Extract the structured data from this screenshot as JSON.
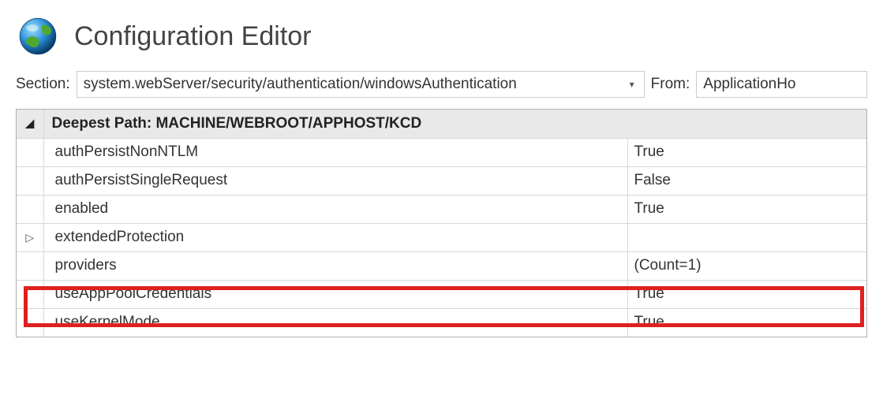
{
  "header": {
    "title": "Configuration Editor"
  },
  "toolbar": {
    "section_label": "Section:",
    "section_value": "system.webServer/security/authentication/windowsAuthentication",
    "from_label": "From:",
    "from_value": "ApplicationHo"
  },
  "grid": {
    "header_label": "Deepest Path: ",
    "header_path": "MACHINE/WEBROOT/APPHOST/KCD",
    "rows": [
      {
        "name": "authPersistNonNTLM",
        "value": "True",
        "expandable": false
      },
      {
        "name": "authPersistSingleRequest",
        "value": "False",
        "expandable": false
      },
      {
        "name": "enabled",
        "value": "True",
        "expandable": false
      },
      {
        "name": "extendedProtection",
        "value": "",
        "expandable": true
      },
      {
        "name": "providers",
        "value": "(Count=1)",
        "expandable": false
      },
      {
        "name": "useAppPoolCredentials",
        "value": "True",
        "expandable": false
      },
      {
        "name": "useKernelMode",
        "value": "True",
        "expandable": false
      }
    ]
  }
}
